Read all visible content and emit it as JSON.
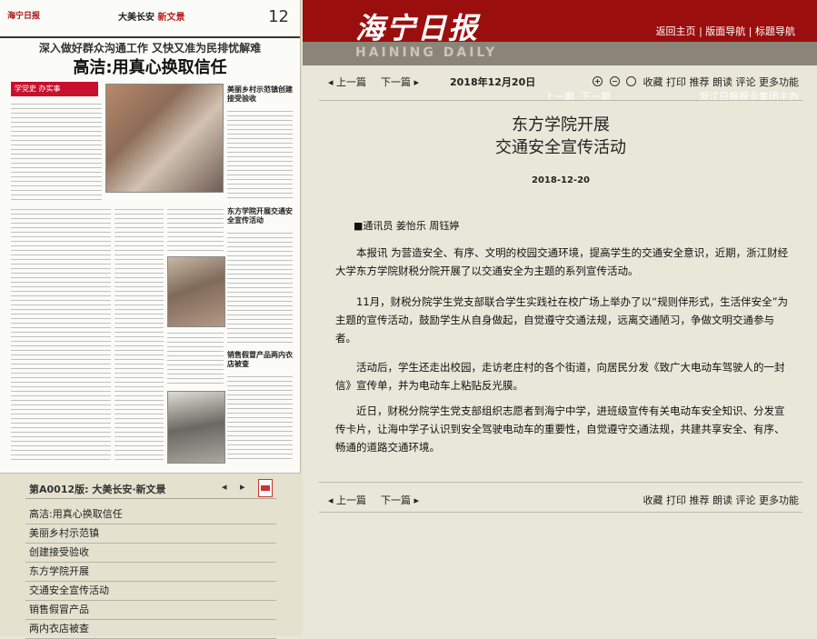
{
  "thumbnail": {
    "masthead_logo": "海宁日报",
    "page_number": "12",
    "section": "大美长安",
    "section_highlight": "新文景",
    "headline_deck": "深入做好群众沟通工作 又快又准为民排忧解难",
    "headline_main": "高洁:用真心换取信任",
    "badge": "学党史 办实事",
    "subhead_1": "美丽乡村示范镇创建接受验收",
    "subhead_2": "东方学院开展交通安全宣传活动",
    "subhead_3": "销售假冒产品两内衣店被查"
  },
  "page_toolbar": {
    "label": "第A0012版:",
    "section": "大美长安·新文景",
    "prev_arrow": "◂",
    "next_arrow": "▸",
    "pdf_icon": "pdf-icon"
  },
  "article_list": [
    "高洁:用真心换取信任",
    "美丽乡村示范镇",
    "创建接受验收",
    "东方学院开展",
    "交通安全宣传活动",
    "销售假冒产品",
    "两内衣店被查"
  ],
  "header": {
    "logo_cn": "海宁日报",
    "logo_en": "HAINING DAILY",
    "link_home": "返回主页",
    "link_layout": "版面导航",
    "link_titles": "标题导航",
    "sep": "|",
    "prev_issue": "上一期",
    "next_issue": "下一期",
    "group": "浙江日报报业集团主办"
  },
  "article_bar": {
    "prev": "上一篇",
    "next": "下一篇",
    "date": "2018年12月20日",
    "tools": [
      "收藏",
      "打印",
      "推荐",
      "朗读",
      "评论",
      "更多功能"
    ],
    "colors": {
      "banner": "#9b0e0e",
      "banner2": "#8a8578",
      "background": "#e9e7d9"
    }
  },
  "article": {
    "title_line1": "东方学院开展",
    "title_line2": "交通安全宣传活动",
    "date": "2018-12-20",
    "byline": "■通讯员 姜怡乐 周钰婷",
    "paragraphs": [
      "本报讯 为营造安全、有序、文明的校园交通环境，提高学生的交通安全意识，近期，浙江财经大学东方学院财税分院开展了以交通安全为主题的系列宣传活动。",
      "11月，财税分院学生党支部联合学生实践社在校广场上举办了以“规则伴形式，生活伴安全”为主题的宣传活动，鼓励学生从自身做起，自觉遵守交通法规，远离交通陋习，争做文明交通参与者。",
      "活动后，学生还走出校园，走访老庄村的各个街道，向居民分发《致广大电动车驾驶人的一封信》宣传单，并为电动车上粘贴反光膜。",
      "近日，财税分院学生党支部组织志愿者到海宁中学，进班级宣传有关电动车安全知识、分发宣传卡片，让海中学子认识到安全驾驶电动车的重要性，自觉遵守交通法规，共建共享安全、有序、畅通的道路交通环境。"
    ]
  }
}
